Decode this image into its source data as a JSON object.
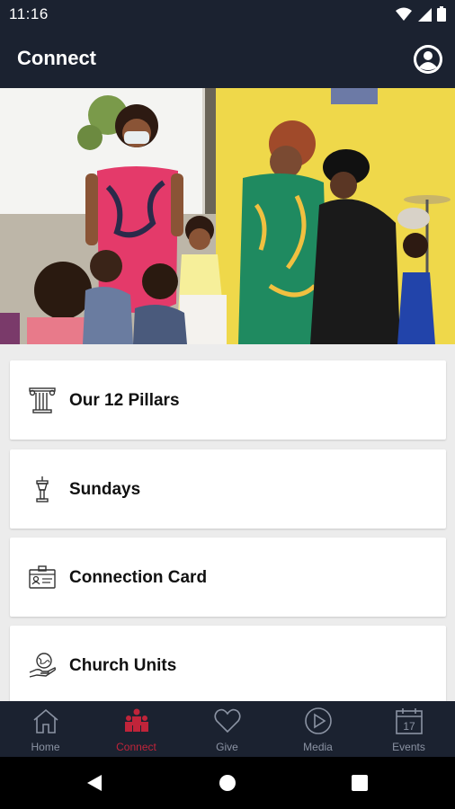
{
  "status": {
    "time": "11:16"
  },
  "header": {
    "title": "Connect"
  },
  "cards": [
    {
      "label": "Our 12 Pillars",
      "icon": "pillar-icon"
    },
    {
      "label": "Sundays",
      "icon": "podium-icon"
    },
    {
      "label": "Connection Card",
      "icon": "id-card-icon"
    },
    {
      "label": "Church Units",
      "icon": "globe-hand-icon"
    }
  ],
  "nav": {
    "items": [
      {
        "label": "Home",
        "icon": "home-icon",
        "active": false
      },
      {
        "label": "Connect",
        "icon": "people-icon",
        "active": true
      },
      {
        "label": "Give",
        "icon": "heart-icon",
        "active": false
      },
      {
        "label": "Media",
        "icon": "play-icon",
        "active": false
      },
      {
        "label": "Events",
        "icon": "calendar-icon",
        "active": false
      }
    ],
    "calendar_day": "17"
  },
  "colors": {
    "bar_bg": "#1b2230",
    "accent": "#c0243a",
    "inactive": "#8b93a3",
    "page_bg": "#ececec"
  }
}
